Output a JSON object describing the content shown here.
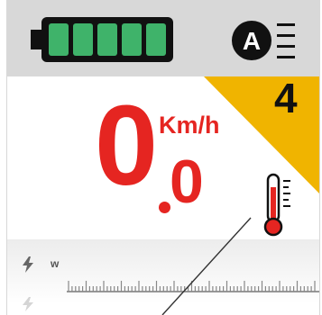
{
  "battery": {
    "level": 1.0,
    "segments": 5,
    "color": "#3fb36a",
    "icon": "battery-icon"
  },
  "assist_mode": {
    "letter": "A",
    "icon": "auto-mode-icon"
  },
  "gear": {
    "number": "4",
    "badge_color": "#f0b400"
  },
  "speed": {
    "integer": "0",
    "decimal": "0",
    "unit": "Km/h",
    "color": "#e52521"
  },
  "temperature": {
    "icon": "thermometer-icon"
  },
  "power": {
    "unit": "w",
    "icon": "bolt-icon"
  }
}
